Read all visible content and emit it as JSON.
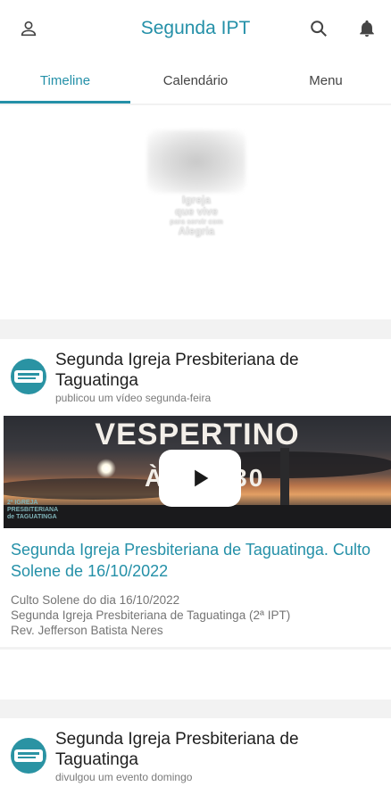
{
  "header": {
    "title": "Segunda IPT",
    "icons": [
      "account-icon",
      "search-icon",
      "bell-icon"
    ]
  },
  "tabs": [
    {
      "label": "Timeline",
      "active": true
    },
    {
      "label": "Calendário",
      "active": false
    },
    {
      "label": "Menu",
      "active": false
    }
  ],
  "banner": {
    "logo_line1": "Igreja",
    "logo_line2": "que vive",
    "logo_line3": "para servir com",
    "logo_line4": "Alegria"
  },
  "posts": [
    {
      "author": "Segunda Igreja Presbiteriana de Taguatinga",
      "action": "publicou um vídeo segunda-feira",
      "video": {
        "overlay_title": "VESPERTINO",
        "overlay_time": "ÀS 18:30",
        "corner_logo": "2ª IGREJA PRESBITERIANA de TAGUATINGA"
      },
      "title": "Segunda Igreja Presbiteriana de Taguatinga. Culto Solene de 16/10/2022",
      "description": [
        "Culto Solene do dia 16/10/2022",
        "Segunda Igreja Presbiteriana de Taguatinga (2ª IPT)",
        "Rev. Jefferson Batista Neres"
      ]
    },
    {
      "author": "Segunda Igreja Presbiteriana de Taguatinga",
      "action": "divulgou um evento domingo"
    }
  ],
  "colors": {
    "accent": "#2490a8",
    "background": "#f2f2f2"
  }
}
